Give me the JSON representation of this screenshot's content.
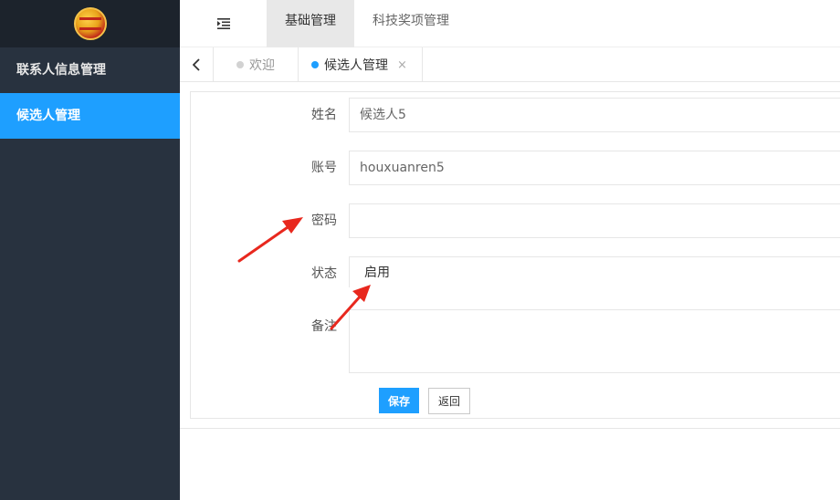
{
  "sidebar": {
    "items": [
      {
        "label": "联系人信息管理",
        "active": false
      },
      {
        "label": "候选人管理",
        "active": true
      }
    ]
  },
  "header": {
    "tabs": [
      {
        "label": "基础管理",
        "active": true
      },
      {
        "label": "科技奖项管理",
        "active": false
      }
    ]
  },
  "tabbar": {
    "tabs": [
      {
        "label": "欢迎",
        "active": false
      },
      {
        "label": "候选人管理",
        "active": true,
        "close": "×"
      }
    ]
  },
  "form": {
    "name_label": "姓名",
    "name_value": "候选人5",
    "account_label": "账号",
    "account_value": "houxuanren5",
    "password_label": "密码",
    "password_value": "",
    "status_label": "状态",
    "status_value": "启用",
    "remark_label": "备注",
    "save_label": "保存",
    "back_label": "返回"
  },
  "colors": {
    "sidebar_bg": "#28323f",
    "accent": "#1e9fff",
    "annotation_arrow": "#e8281e"
  }
}
